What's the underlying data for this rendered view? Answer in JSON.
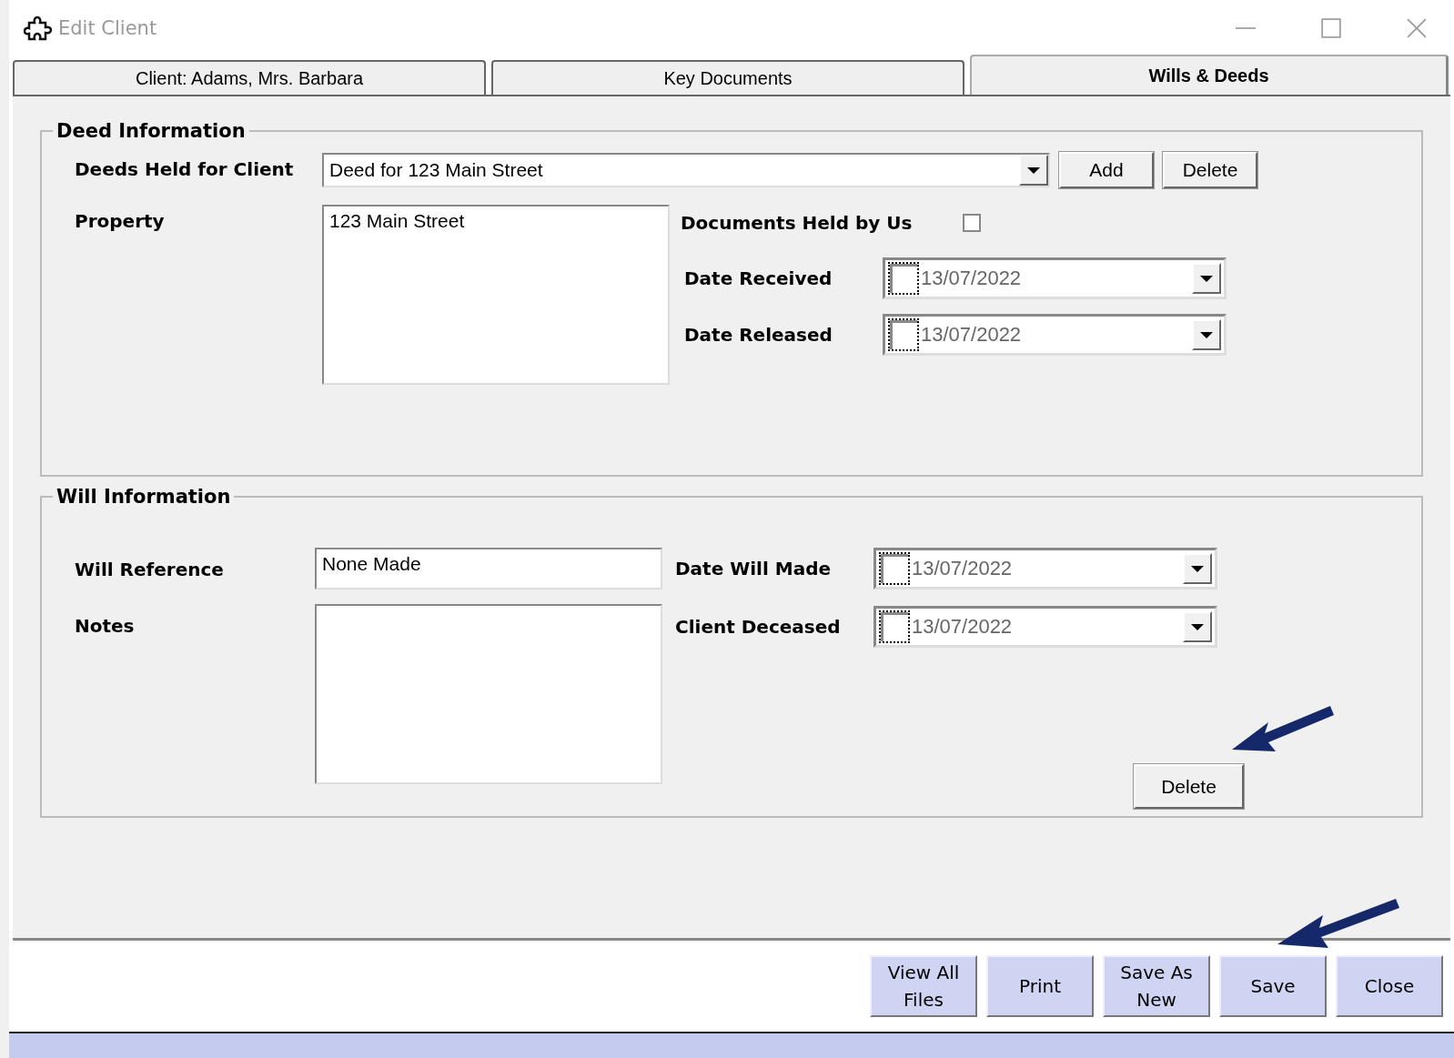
{
  "window": {
    "title": "Edit Client"
  },
  "tabs": [
    {
      "label": "Client: Adams, Mrs. Barbara",
      "selected": false
    },
    {
      "label": "Key Documents",
      "selected": false
    },
    {
      "label": "Wills & Deeds",
      "selected": true
    }
  ],
  "deed_information": {
    "title": "Deed Information",
    "deeds_held": {
      "label": "Deeds Held for Client",
      "value": "Deed for 123 Main Street",
      "buttons": [
        "Add",
        "Delete"
      ]
    },
    "property": {
      "label": "Property",
      "value": "123 Main Street"
    },
    "documents_held": {
      "label": "Documents Held by Us",
      "checked": false
    },
    "dates": [
      {
        "label": "Date Received",
        "value": "13/07/2022",
        "checked": false
      },
      {
        "label": "Date Released",
        "value": "13/07/2022",
        "checked": false
      }
    ]
  },
  "will_information": {
    "title": "Will Information",
    "will_reference": {
      "label": "Will Reference",
      "value": "None Made"
    },
    "notes": {
      "label": "Notes"
    },
    "dates": [
      {
        "label": "Date Will Made",
        "value": "13/07/2022",
        "checked": false
      },
      {
        "label": "Client Deceased",
        "value": "13/07/2022",
        "checked": false
      }
    ],
    "delete_button": "Delete"
  },
  "footer_buttons": [
    {
      "label": "View All Files"
    },
    {
      "label": "Print"
    },
    {
      "label": "Save As New"
    },
    {
      "label": "Save"
    },
    {
      "label": "Close"
    }
  ]
}
